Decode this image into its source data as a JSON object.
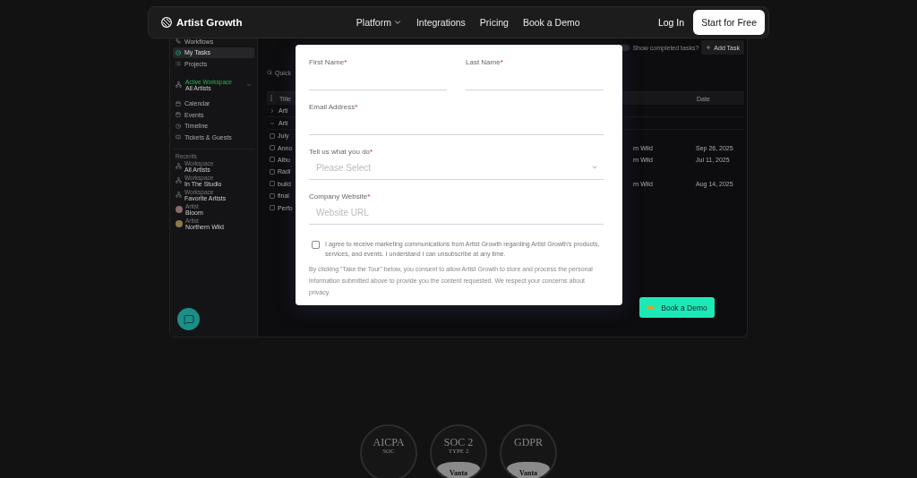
{
  "nav": {
    "brand": "Artist Growth",
    "links": [
      {
        "label": "Platform",
        "dropdown": true
      },
      {
        "label": "Integrations",
        "dropdown": false
      },
      {
        "label": "Pricing",
        "dropdown": false
      },
      {
        "label": "Book a Demo",
        "dropdown": false
      }
    ],
    "login": "Log In",
    "cta": "Start for Free"
  },
  "app": {
    "sidebar": {
      "top_items": [
        {
          "label": "Workflows",
          "selected": false
        },
        {
          "label": "My Tasks",
          "selected": true
        },
        {
          "label": "Projects",
          "selected": false
        }
      ],
      "workspace": {
        "caption": "Active Workspace",
        "name": "All Artists"
      },
      "menu": [
        {
          "label": "Calendar"
        },
        {
          "label": "Events"
        },
        {
          "label": "Timeline"
        },
        {
          "label": "Tickets & Guests"
        }
      ],
      "recents_title": "Recents",
      "recents": [
        {
          "kind": "workspace",
          "caption": "Workspace",
          "name": "All Artists"
        },
        {
          "kind": "workspace",
          "caption": "Workspace",
          "name": "In The Studio"
        },
        {
          "kind": "workspace",
          "caption": "Workspace",
          "name": "Favorite Artists"
        },
        {
          "kind": "artist",
          "caption": "Artist",
          "name": "Bloom",
          "color": "#8a6a6a"
        },
        {
          "kind": "artist",
          "caption": "Artist",
          "name": "Northern Wild",
          "color": "#8a7a4a"
        }
      ]
    },
    "toolbar": {
      "toggle_on": false,
      "toggle_label": "Show completed tasks?",
      "add_button": "Add Task"
    },
    "search": {
      "placeholder": "Quick"
    },
    "table": {
      "columns": [
        "Title",
        "Date"
      ],
      "groups": [
        {
          "label": "Arti",
          "expanded": false
        },
        {
          "label": "Arti",
          "expanded": true
        }
      ],
      "rows": [
        {
          "checked": false,
          "title": "July",
          "artist": "",
          "date": ""
        },
        {
          "checked": false,
          "title": "Anno",
          "artist": "rn Wild",
          "date": "Sep 26, 2025"
        },
        {
          "checked": false,
          "title": "Albu",
          "artist": "rn Wild",
          "date": "Jul 11, 2025"
        },
        {
          "checked": false,
          "title": "Radi",
          "artist": "",
          "date": ""
        },
        {
          "checked": false,
          "title": "build",
          "artist": "rn Wild",
          "date": "Aug 14, 2025"
        },
        {
          "checked": false,
          "title": "final",
          "artist": "",
          "date": ""
        },
        {
          "checked": false,
          "title": "Perfo",
          "artist": "",
          "date": ""
        }
      ]
    },
    "demo_button": "Book a Demo"
  },
  "form": {
    "fields": [
      {
        "kind": "text",
        "label": "First Name",
        "required_mark": "*"
      },
      {
        "kind": "text",
        "label": "Last Name",
        "required_mark": "*"
      },
      {
        "kind": "text",
        "label": "Email Address",
        "required_mark": "*"
      },
      {
        "kind": "select",
        "label": "Tell us what you do",
        "required_mark": "*",
        "placeholder": "Please Select"
      },
      {
        "kind": "text",
        "label": "Company Website",
        "required_mark": "*",
        "placeholder": "Website URL"
      }
    ],
    "consent": {
      "checked": false,
      "text": "I agree to receive marketing communications from Artist Growth regarding Artist Growth's products, services, and events. I understand I can unsubscribe at any time."
    },
    "notice": "By clicking \"Take the Tour\" below, you consent to allow Artist Growth to store and process the personal information submitted above to provide you the content requested. We respect your concerns about privacy."
  },
  "badges": [
    {
      "lines": [
        "AICPA",
        "SOC"
      ]
    },
    {
      "lines": [
        "SOC 2",
        "TYPE 2"
      ],
      "footer": "Vanta"
    },
    {
      "lines": [
        "GDPR"
      ],
      "footer": "Vanta"
    }
  ]
}
